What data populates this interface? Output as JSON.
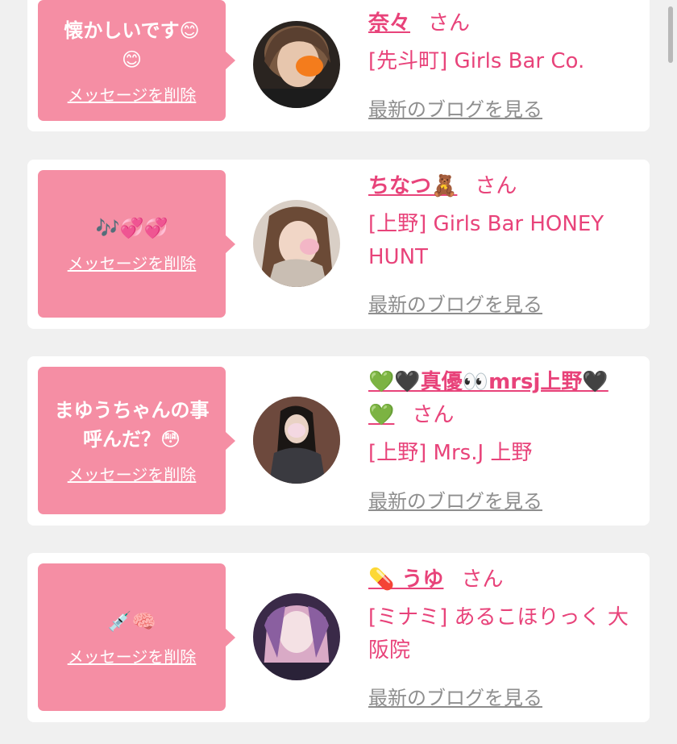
{
  "delete_label": "メッセージを削除",
  "blog_label": "最新のブログを見る",
  "honorific": "さん",
  "messages": [
    {
      "text_1": "懐かしいです😊",
      "text_2": "😊",
      "name": "奈々",
      "shop": "[先斗町] Girls Bar Co."
    },
    {
      "text_1": "🎶💞💞",
      "name": "ちなつ🧸",
      "shop": "[上野] Girls Bar HONEY HUNT"
    },
    {
      "text_1": "まゆうちゃんの事",
      "text_2": "呼んだ？😳",
      "name_1": "💚🖤真優👀mrsj上野🖤",
      "name_2": "💚",
      "shop": "[上野] Mrs.J 上野"
    },
    {
      "text_1": "💉🧠",
      "name": "💊 うゆ",
      "shop": "[ミナミ] あるこほりっく 大阪院"
    }
  ]
}
